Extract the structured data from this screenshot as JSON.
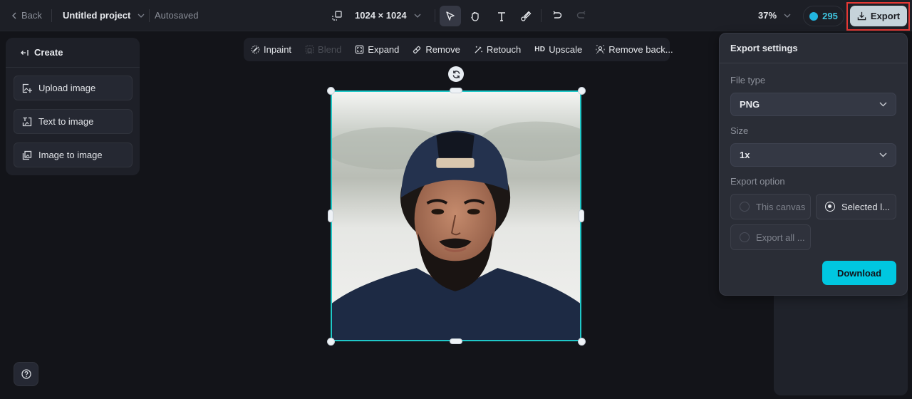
{
  "topbar": {
    "back_label": "Back",
    "project_name": "Untitled project",
    "save_status": "Autosaved",
    "canvas_size": "1024 × 1024",
    "tools": [
      {
        "name": "select",
        "icon": "cursor-icon",
        "active": true
      },
      {
        "name": "hand",
        "icon": "hand-icon",
        "active": false
      },
      {
        "name": "text",
        "icon": "text-icon",
        "active": false
      },
      {
        "name": "brush",
        "icon": "brush-icon",
        "active": false
      },
      {
        "name": "undo",
        "icon": "undo-icon",
        "active": false
      },
      {
        "name": "redo",
        "icon": "redo-icon",
        "active": false,
        "disabled": true
      }
    ],
    "zoom_level": "37%",
    "credits": "295",
    "export_label": "Export"
  },
  "left_panel": {
    "title": "Create",
    "items": [
      {
        "label": "Upload image",
        "icon": "upload-image-icon"
      },
      {
        "label": "Text to image",
        "icon": "text-to-image-icon"
      },
      {
        "label": "Image to image",
        "icon": "image-to-image-icon"
      }
    ]
  },
  "edit_toolbar": {
    "items": [
      {
        "label": "Inpaint",
        "icon": "inpaint-icon",
        "disabled": false
      },
      {
        "label": "Blend",
        "icon": "blend-icon",
        "disabled": true
      },
      {
        "label": "Expand",
        "icon": "expand-icon",
        "disabled": false
      },
      {
        "label": "Remove",
        "icon": "eraser-icon",
        "disabled": false
      },
      {
        "label": "Retouch",
        "icon": "magic-wand-icon",
        "disabled": false
      },
      {
        "label": "Upscale",
        "icon": "hd-icon",
        "badge": "HD",
        "disabled": false
      },
      {
        "label": "Remove back...",
        "icon": "remove-background-icon",
        "disabled": false
      }
    ]
  },
  "export_settings": {
    "title": "Export settings",
    "file_type_label": "File type",
    "file_type_value": "PNG",
    "size_label": "Size",
    "size_value": "1x",
    "export_option_label": "Export option",
    "options": [
      {
        "label": "This canvas",
        "selected": false
      },
      {
        "label": "Selected l...",
        "selected": true
      },
      {
        "label": "Export all ...",
        "selected": false
      }
    ],
    "download_label": "Download"
  },
  "colors": {
    "accent": "#00c7e0",
    "selection": "#1fc8c8",
    "highlight": "#e53935"
  }
}
